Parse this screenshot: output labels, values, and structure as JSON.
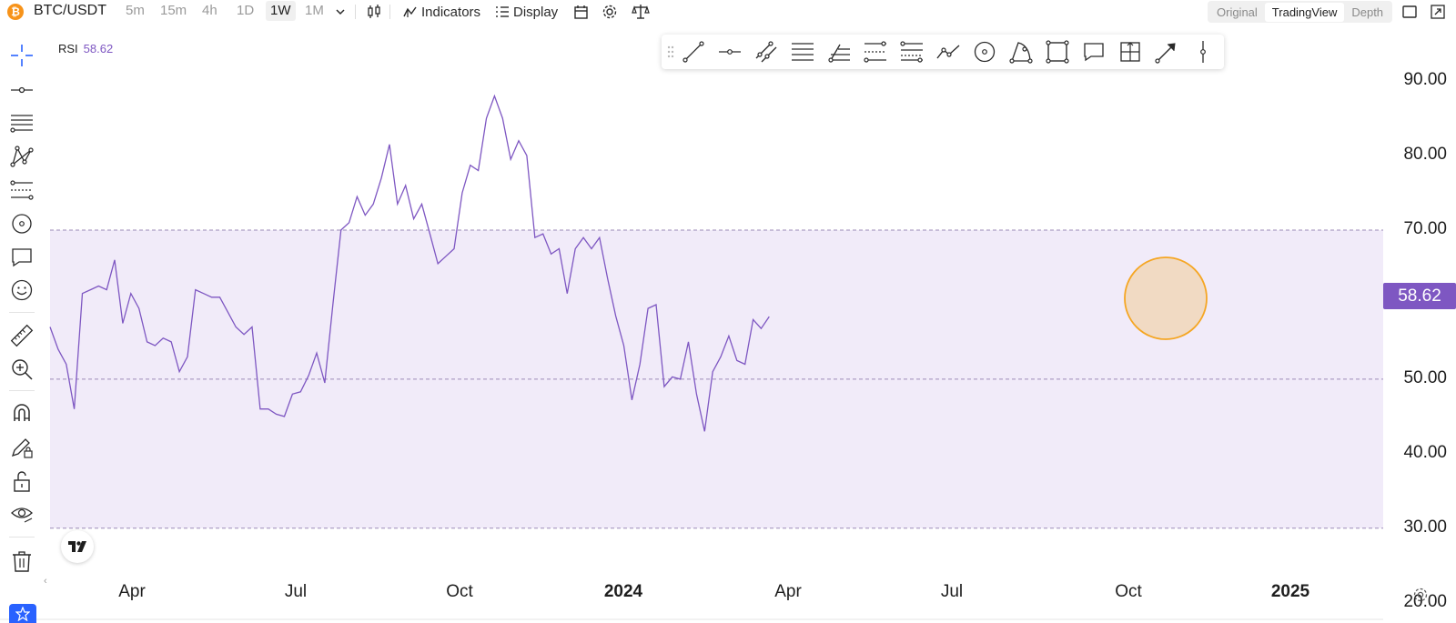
{
  "header": {
    "coin_glyph": "₿",
    "symbol": "BTC/USDT",
    "intervals": [
      "5m",
      "15m",
      "4h",
      "1D",
      "1W",
      "1M"
    ],
    "active_interval": "1W",
    "indicators_label": "Indicators",
    "display_label": "Display",
    "views": [
      "Original",
      "TradingView",
      "Depth"
    ],
    "active_view": "TradingView"
  },
  "indicator": {
    "name": "RSI",
    "value": "58.62",
    "color": "#7e57c2",
    "band_upper": 70,
    "band_lower": 30,
    "midline": 50
  },
  "chart_data": {
    "type": "line",
    "y_ticks": [
      "90.00",
      "80.00",
      "70.00",
      "50.00",
      "40.00",
      "30.00",
      "20.00"
    ],
    "y_tick_values": [
      90,
      80,
      70,
      50,
      40,
      30,
      20
    ],
    "ylim": [
      18.5,
      96
    ],
    "x_ticks": [
      {
        "label": "Apr",
        "bold": false
      },
      {
        "label": "Jul",
        "bold": false
      },
      {
        "label": "Oct",
        "bold": false
      },
      {
        "label": "2024",
        "bold": true
      },
      {
        "label": "Apr",
        "bold": false
      },
      {
        "label": "Jul",
        "bold": false
      },
      {
        "label": "Oct",
        "bold": false
      },
      {
        "label": "2025",
        "bold": true
      }
    ],
    "last_value_label": "58.62",
    "highlight_color": "#f5a623",
    "series": [
      {
        "values": [
          57,
          54,
          52,
          46,
          61.5,
          62,
          62.5,
          62,
          66,
          57.5,
          61.5,
          59.5,
          55,
          54.5,
          55.5,
          55,
          51,
          53,
          62,
          61.5,
          61,
          61,
          59,
          57,
          56,
          57,
          46,
          46,
          45.3,
          45,
          48,
          48.3,
          50.5,
          53.5,
          49.5,
          60,
          70,
          71,
          74.5,
          72,
          73.5,
          77,
          81.5,
          73.5,
          76,
          71.5,
          73.5,
          69.5,
          65.5,
          66.5,
          67.5,
          75,
          78.7,
          78,
          85,
          88,
          85,
          79.5,
          82,
          80,
          69,
          69.5,
          66.8,
          67.5,
          61.5,
          67.5,
          69,
          67.5,
          69,
          63.5,
          58.5,
          54.5,
          47.2,
          52,
          59.5,
          60,
          49,
          50.3,
          50,
          55,
          48,
          43,
          51,
          53,
          55.8,
          52.5,
          52,
          58,
          56.8,
          58.4
        ]
      }
    ]
  }
}
